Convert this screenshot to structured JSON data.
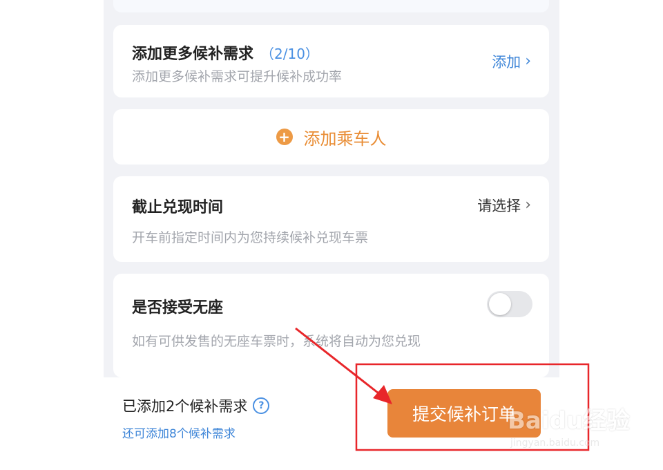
{
  "more_requests": {
    "title": "添加更多候补需求",
    "count": "（2/10）",
    "subtitle": "添加更多候补需求可提升候补成功率",
    "action_label": "添加"
  },
  "passenger": {
    "label": "添加乘车人"
  },
  "deadline": {
    "title": "截止兑现时间",
    "action_label": "请选择",
    "subtitle": "开车前指定时间内为您持续候补兑现车票"
  },
  "no_seat": {
    "title": "是否接受无座",
    "subtitle": "如有可供发售的无座车票时，系统将自动为您兑现",
    "enabled": false
  },
  "footer": {
    "added_text": "已添加2个候补需求",
    "remaining_text": "还可添加8个候补需求",
    "submit_label": "提交候补订单"
  },
  "watermark": {
    "brand": "Baidu经验",
    "url": "jingyan.baidu.com"
  },
  "colors": {
    "accent_orange": "#e8853a",
    "link_blue": "#3f86d8",
    "annotation_red": "#e8262a"
  },
  "icons": {
    "chevron": "chevron-right-icon",
    "plus": "plus-circle-icon",
    "help": "question-circle-icon"
  }
}
